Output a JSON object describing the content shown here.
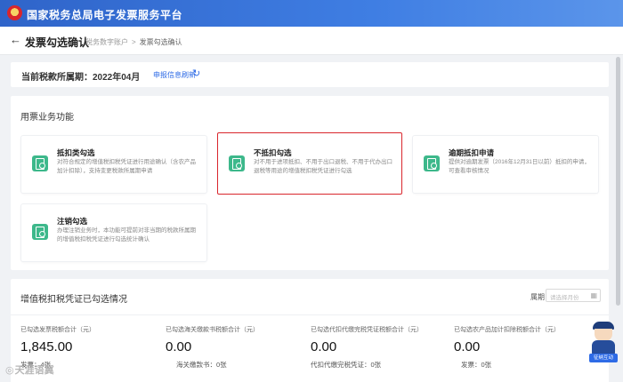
{
  "header": {
    "title": "国家税务总局电子发票服务平台",
    "emblem_icon": "national-emblem-icon"
  },
  "subheader": {
    "back_icon": "←",
    "page_title": "发票勾选确认",
    "breadcrumb": [
      "税务数字账户",
      "发票勾选确认"
    ],
    "separator": ">"
  },
  "period": {
    "label": "当前税款所属期：2022年04月",
    "refresh_text": "申报信息刷新",
    "refresh_icon": "↻"
  },
  "functions": {
    "section_title": "用票业务功能",
    "selected_index": 1,
    "tiles": [
      {
        "name": "抵扣类勾选",
        "desc": "对符合规定的增值税扣税凭证进行用途确认（含农产品加计扣除），支持变更税款所属期申请",
        "icon": "invoice-check-icon"
      },
      {
        "name": "不抵扣勾选",
        "desc": "对不用于进项抵扣、不用于出口退税、不用于代办出口退税等用途的增值税扣税凭证进行勾选",
        "icon": "invoice-exclude-icon"
      },
      {
        "name": "逾期抵扣申请",
        "desc": "提供对逾期发票（2016年12月31日以前）抵扣的申请，可查看审核情况",
        "icon": "overdue-apply-icon"
      },
      {
        "name": "注销勾选",
        "desc": "办理注销业务时，本功能可提前对非当期的税款所属期的增值税扣税凭证进行勾选统计确认",
        "icon": "cancel-check-icon"
      }
    ]
  },
  "stats": {
    "section_title": "增值税扣税凭证已勾选情况",
    "period_label": "属期",
    "month_placeholder": "请选择月份",
    "calendar_icon": "calendar-icon",
    "items": [
      {
        "label": "已勾选发票税额合计（元）",
        "value": "1,845.00",
        "sub": "发票：4张"
      },
      {
        "label": "已勾选海关缴款书税额合计（元）",
        "value": "0.00",
        "sub": "海关缴款书：0张"
      },
      {
        "label": "已勾选代扣代缴完税凭证税额合计（元）",
        "value": "0.00",
        "sub": "代扣代缴完税凭证：0张"
      },
      {
        "label": "已勾选农产品加计扣除税额合计（元）",
        "value": "0.00",
        "sub": "发票：0张"
      }
    ]
  },
  "assistant": {
    "label": "征纳互动"
  },
  "watermark": {
    "text": "天涯语冀"
  },
  "colors": {
    "brand_blue": "#2f64c9",
    "icon_green": "#3db88b",
    "highlight_red": "#d9262c",
    "link_blue": "#2e6be6"
  }
}
